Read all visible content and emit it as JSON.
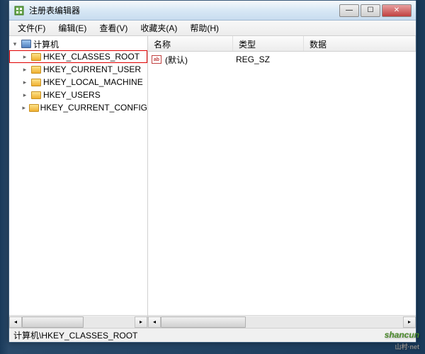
{
  "window": {
    "title": "注册表编辑器"
  },
  "menu": {
    "file": "文件(F)",
    "edit": "编辑(E)",
    "view": "查看(V)",
    "favorites": "收藏夹(A)",
    "help": "帮助(H)"
  },
  "tree": {
    "root": "计算机",
    "nodes": [
      "HKEY_CLASSES_ROOT",
      "HKEY_CURRENT_USER",
      "HKEY_LOCAL_MACHINE",
      "HKEY_USERS",
      "HKEY_CURRENT_CONFIG"
    ]
  },
  "list": {
    "headers": {
      "name": "名称",
      "type": "类型",
      "data": "数据"
    },
    "rows": [
      {
        "name": "(默认)",
        "type": "REG_SZ",
        "data": ""
      }
    ]
  },
  "status": {
    "path": "计算机\\HKEY_CLASSES_ROOT"
  },
  "watermark": {
    "main": "shancun",
    "sub": "山村·net"
  }
}
